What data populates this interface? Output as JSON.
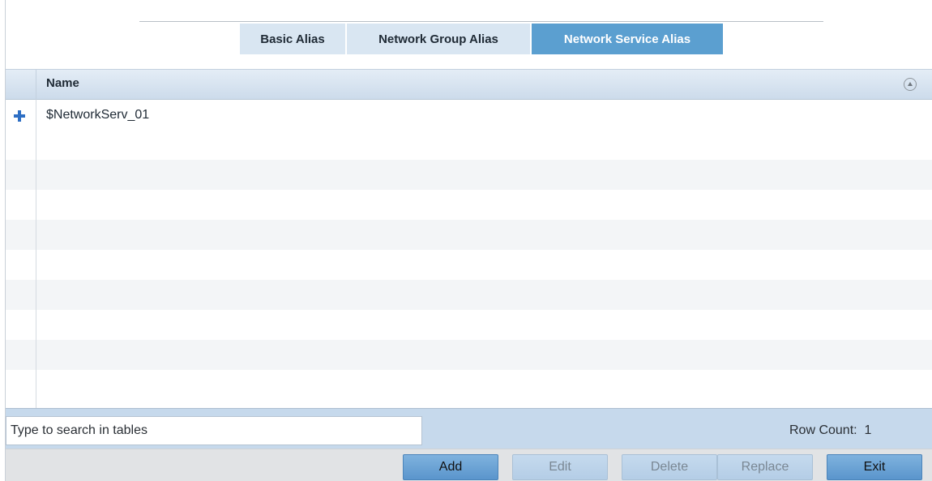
{
  "tabs": [
    {
      "label": "Basic Alias",
      "active": false
    },
    {
      "label": "Network Group Alias",
      "active": false
    },
    {
      "label": "Network Service Alias",
      "active": true
    }
  ],
  "table": {
    "columns": [
      {
        "label": "Name"
      }
    ],
    "rows": [
      {
        "name": "$NetworkServ_01"
      }
    ]
  },
  "footer": {
    "search_placeholder": "Type to search in tables",
    "row_count_label": "Row Count:  1"
  },
  "buttons": {
    "add": "Add",
    "edit": "Edit",
    "delete": "Delete",
    "replace": "Replace",
    "exit": "Exit"
  },
  "colors": {
    "active_tab": "#5b9fd0",
    "inactive_tab": "#d9e6f2",
    "footer_bar": "#c6d9ec",
    "expand_icon": "#2e6fc4"
  }
}
